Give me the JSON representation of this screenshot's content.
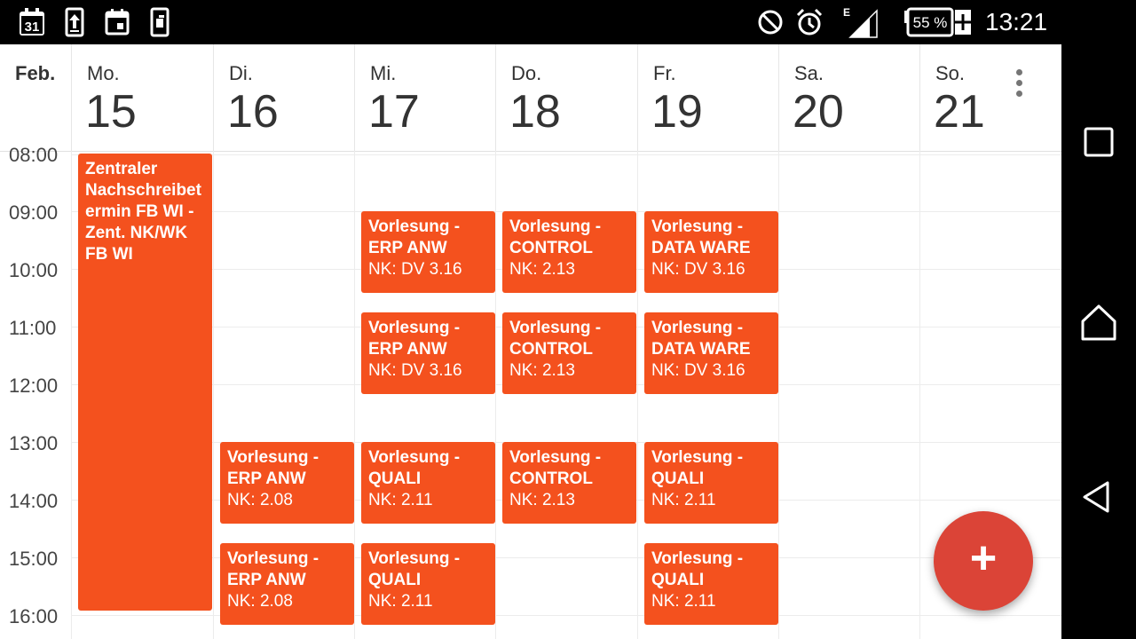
{
  "status_bar": {
    "time": "13:21",
    "battery": "55 %",
    "network_type": "E",
    "left_icons": [
      "calendar-date-icon",
      "upload-icon",
      "calendar-event-icon",
      "phone-sync-icon"
    ],
    "right_icons": [
      "do-not-disturb-icon",
      "alarm-icon",
      "signal-icon",
      "battery-charging-icon"
    ],
    "calendar_icon_date": "31"
  },
  "header": {
    "month": "Feb.",
    "days": [
      {
        "weekday": "Mo.",
        "date": "15"
      },
      {
        "weekday": "Di.",
        "date": "16"
      },
      {
        "weekday": "Mi.",
        "date": "17"
      },
      {
        "weekday": "Do.",
        "date": "18"
      },
      {
        "weekday": "Fr.",
        "date": "19"
      },
      {
        "weekday": "Sa.",
        "date": "20"
      },
      {
        "weekday": "So.",
        "date": "21"
      }
    ]
  },
  "time_labels": [
    "08:00",
    "09:00",
    "10:00",
    "11:00",
    "12:00",
    "13:00",
    "14:00",
    "15:00",
    "16:00"
  ],
  "events": [
    {
      "day": 0,
      "start": "08:00",
      "end": "15:55",
      "title": "Zentraler\nNachschreibet\nermin FB WI -\nZent. NK/WK\nFB WI",
      "location": ""
    },
    {
      "day": 2,
      "start": "09:00",
      "end": "10:25",
      "title": "Vorlesung -\nERP ANW",
      "location": "NK: DV 3.16"
    },
    {
      "day": 3,
      "start": "09:00",
      "end": "10:25",
      "title": "Vorlesung -\nCONTROL",
      "location": "NK: 2.13"
    },
    {
      "day": 4,
      "start": "09:00",
      "end": "10:25",
      "title": "Vorlesung -\nDATA WARE",
      "location": "NK: DV 3.16"
    },
    {
      "day": 2,
      "start": "10:45",
      "end": "12:10",
      "title": "Vorlesung -\nERP ANW",
      "location": "NK: DV 3.16"
    },
    {
      "day": 3,
      "start": "10:45",
      "end": "12:10",
      "title": "Vorlesung -\nCONTROL",
      "location": "NK: 2.13"
    },
    {
      "day": 4,
      "start": "10:45",
      "end": "12:10",
      "title": "Vorlesung -\nDATA WARE",
      "location": "NK: DV 3.16"
    },
    {
      "day": 1,
      "start": "13:00",
      "end": "14:25",
      "title": "Vorlesung -\nERP ANW",
      "location": "NK: 2.08"
    },
    {
      "day": 2,
      "start": "13:00",
      "end": "14:25",
      "title": "Vorlesung -\nQUALI",
      "location": "NK: 2.11"
    },
    {
      "day": 3,
      "start": "13:00",
      "end": "14:25",
      "title": "Vorlesung -\nCONTROL",
      "location": "NK: 2.13"
    },
    {
      "day": 4,
      "start": "13:00",
      "end": "14:25",
      "title": "Vorlesung -\nQUALI",
      "location": "NK: 2.11"
    },
    {
      "day": 1,
      "start": "14:45",
      "end": "16:10",
      "title": "Vorlesung -\nERP ANW",
      "location": "NK: 2.08"
    },
    {
      "day": 2,
      "start": "14:45",
      "end": "16:10",
      "title": "Vorlesung -\nQUALI",
      "location": "NK: 2.11"
    },
    {
      "day": 4,
      "start": "14:45",
      "end": "16:10",
      "title": "Vorlesung -\nQUALI",
      "location": "NK: 2.11"
    }
  ],
  "fab": {
    "label": "+",
    "icon": "add-icon"
  },
  "navigation_bar": {
    "buttons": [
      "recent-apps-icon",
      "home-icon",
      "back-icon"
    ]
  },
  "colors": {
    "event": "#f4511e",
    "fab": "#db4437",
    "status_bar": "#000000",
    "navigation_bar": "#000000"
  }
}
